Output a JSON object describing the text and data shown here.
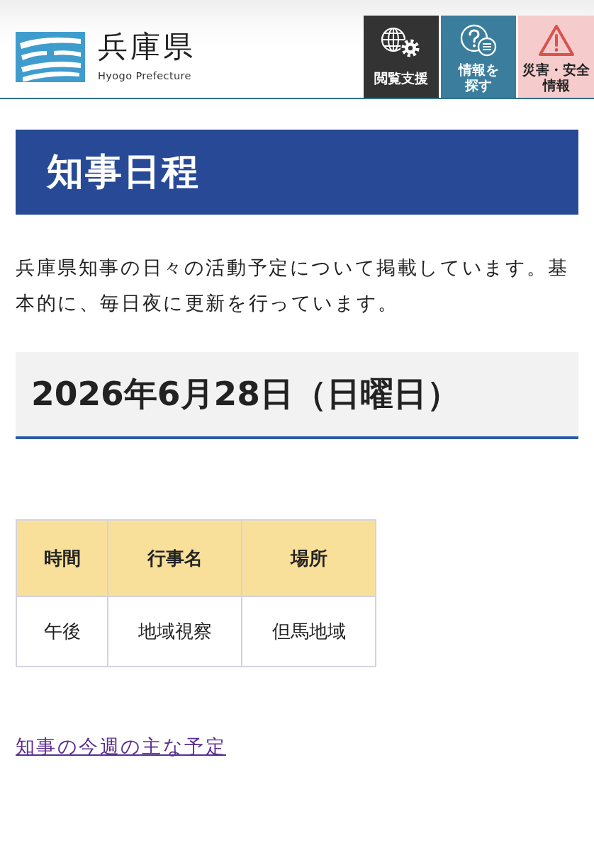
{
  "header": {
    "site_title": "兵庫県",
    "site_subtitle": "Hyogo Prefecture",
    "buttons": [
      {
        "kind": "accessibility",
        "lines": [
          "閲覧支援"
        ]
      },
      {
        "kind": "search",
        "lines": [
          "情報を",
          "探す"
        ]
      },
      {
        "kind": "disaster",
        "lines": [
          "災害・安全",
          "情報"
        ]
      }
    ]
  },
  "page_title": "知事日程",
  "intro": "兵庫県知事の日々の活動予定について掲載しています。基本的に、毎日夜に更新を行っています。",
  "date_heading": "2026年6月28日（日曜日）",
  "table": {
    "columns": [
      "時間",
      "行事名",
      "場所"
    ],
    "rows": [
      [
        "午後",
        "地域視察",
        "但馬地域"
      ]
    ]
  },
  "link": "知事の今週の主な予定"
}
